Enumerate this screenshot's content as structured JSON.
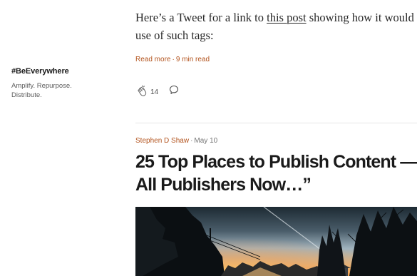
{
  "sidebar": {
    "publication_name": "#BeEverywhere",
    "tagline_lines": [
      "Amplify. Repurpose.",
      "Distribute."
    ]
  },
  "previous_post": {
    "excerpt_line1_before": "Here’s a Tweet for a link to ",
    "excerpt_link": "this post",
    "excerpt_line1_after": " showing how it would look",
    "excerpt_line2": "use of such tags:",
    "read_more": "Read more",
    "separator": "·",
    "read_time": "9 min read",
    "clap_count": "14",
    "icons": {
      "clap": "clap-icon",
      "comment": "comment-icon"
    }
  },
  "next_post": {
    "author": "Stephen D Shaw",
    "separator": "·",
    "date": "May 10",
    "title_lines": [
      "25 Top Places to Publish Content —",
      "All Publishers Now…”"
    ]
  },
  "colors": {
    "accent": "#b3541e",
    "text": "#292929",
    "muted": "#757575",
    "divider": "#e6e6e6"
  }
}
